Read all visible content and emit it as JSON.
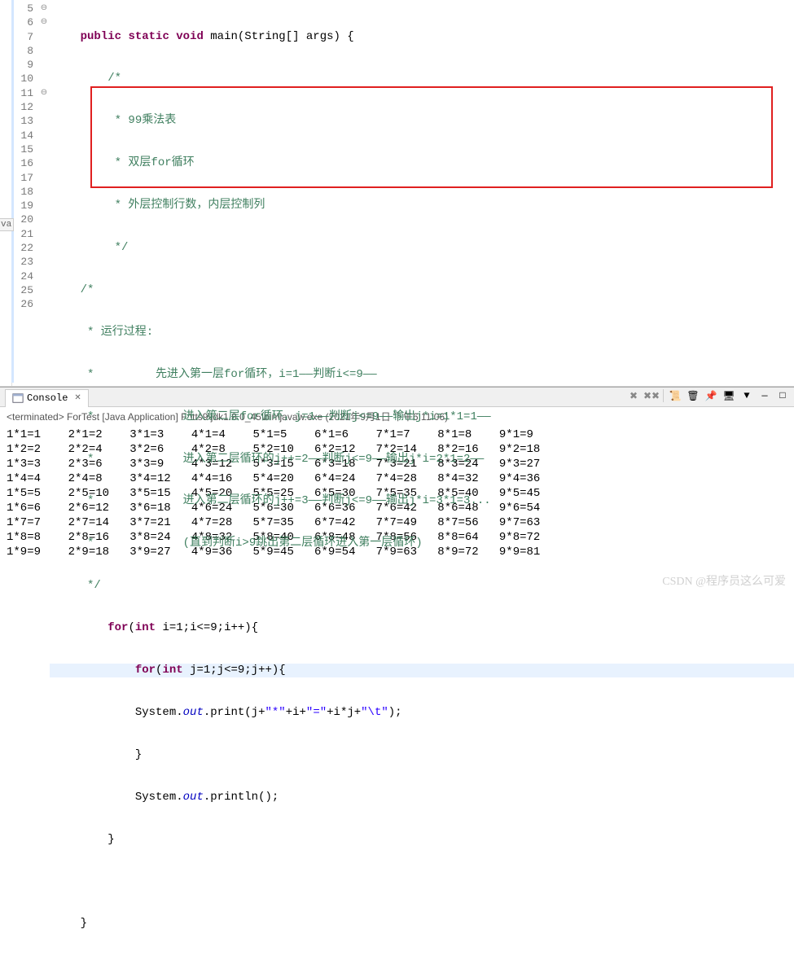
{
  "gutter": [
    "5",
    "6",
    "7",
    "8",
    "9",
    "10",
    "11",
    "12",
    "13",
    "14",
    "15",
    "16",
    "17",
    "18",
    "19",
    "20",
    "21",
    "22",
    "23",
    "24",
    "25",
    "26"
  ],
  "code": {
    "l5": {
      "pre": "    ",
      "kw1": "public",
      "sp1": " ",
      "kw2": "static",
      "sp2": " ",
      "kw3": "void",
      "sp3": " ",
      "m": "main(String[] args) {"
    },
    "l6": "        /*",
    "l7": "         * 99乘法表",
    "l8": "         * 双层for循环",
    "l9": "         * 外层控制行数，内层控制列",
    "l10": "         */",
    "l11": "    /*",
    "l12": "     * 运行过程:",
    "l13": "     *         先进入第一层for循环，i=1——判断i<=9——",
    "l14": "     *             进入第二层for循环，j=1——判断j<=9——输出j*i=1*1=1——",
    "l15": "     *             进入第二层循环的j++=2——判断j<=9——输出j*i=2*1=2——",
    "l16": "     *             进入第二层循环的j++=3——判断j<=9——输出j*i=3*1=3...",
    "l17": "     *             (直到判断i>9跳出第二层循环进入第一层循环)",
    "l18": "     */",
    "l19": {
      "pre": "        ",
      "kw": "for",
      "rest": "(",
      "kw2": "int",
      "rest2": " i=1;i<=9;i++){"
    },
    "l20": {
      "pre": "            ",
      "kw": "for",
      "rest": "(",
      "kw2": "int",
      "rest2": " j=1;j<=9;j++){"
    },
    "l21": {
      "pre": "            System.",
      "fld": "out",
      "m1": ".print(j+",
      "s1": "\"*\"",
      "m2": "+i+",
      "s2": "\"=\"",
      "m3": "+i*j+",
      "s3": "\"\\t\"",
      "m4": ");"
    },
    "l22": "            }",
    "l23": {
      "pre": "            System.",
      "fld": "out",
      "m": ".println();"
    },
    "l24": "        }",
    "l25": "",
    "l26": "    }"
  },
  "sidebar_label": "va",
  "console": {
    "tab_label": "Console",
    "status": "<terminated> ForTest [Java Application] F:\\tts9\\jdk1.8.0_45\\bin\\javaw.exe (2021年9月1日 下午6:11:06)",
    "output": "1*1=1    2*1=2    3*1=3    4*1=4    5*1=5    6*1=6    7*1=7    8*1=8    9*1=9\n1*2=2    2*2=4    3*2=6    4*2=8    5*2=10   6*2=12   7*2=14   8*2=16   9*2=18\n1*3=3    2*3=6    3*3=9    4*3=12   5*3=15   6*3=18   7*3=21   8*3=24   9*3=27\n1*4=4    2*4=8    3*4=12   4*4=16   5*4=20   6*4=24   7*4=28   8*4=32   9*4=36\n1*5=5    2*5=10   3*5=15   4*5=20   5*5=25   6*5=30   7*5=35   8*5=40   9*5=45\n1*6=6    2*6=12   3*6=18   4*6=24   5*6=30   6*6=36   7*6=42   8*6=48   9*6=54\n1*7=7    2*7=14   3*7=21   4*7=28   5*7=35   6*7=42   7*7=49   8*7=56   9*7=63\n1*8=8    2*8=16   3*8=24   4*8=32   5*8=40   6*8=48   7*8=56   8*8=64   9*8=72\n1*9=9    2*9=18   3*9=27   4*9=36   5*9=45   6*9=54   7*9=63   8*9=72   9*9=81"
  },
  "toolbar_icons": {
    "remove": "✕",
    "remove_all": "✕✕",
    "scroll": "📜",
    "pin": "📌",
    "display": "🖥",
    "open": "📂",
    "min": "—",
    "max": "□"
  },
  "watermark": "CSDN @程序员这么可爱"
}
